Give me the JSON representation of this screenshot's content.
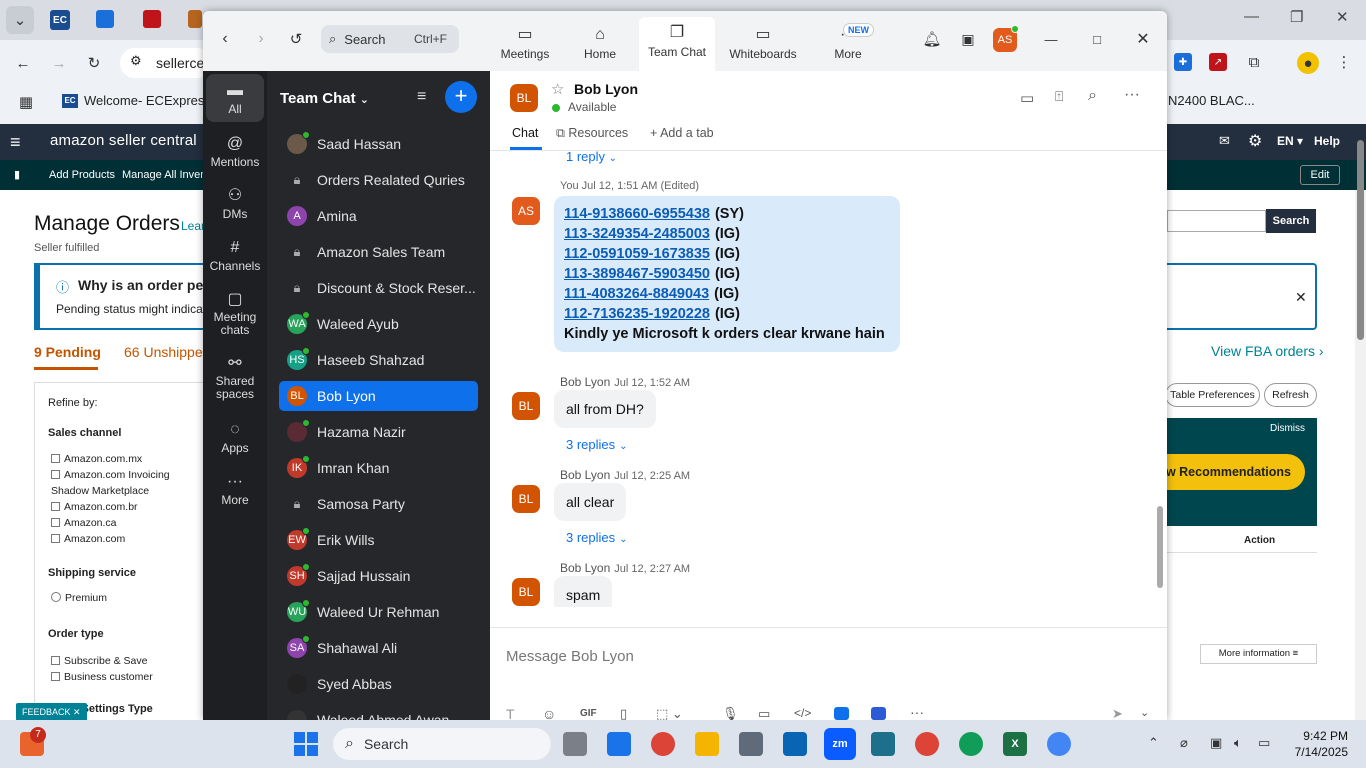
{
  "browser": {
    "tab_texts": [
      "EC",
      "",
      "",
      ""
    ],
    "address": "sellerce",
    "bookmark": "Welcome- ECExpres...",
    "right_fragment": "N2400 BLAC..."
  },
  "amazon": {
    "brand": "amazon seller central",
    "nav_right": [
      "EN ▾",
      "Help"
    ],
    "subnav": [
      "Add Products",
      "Manage All Invento"
    ],
    "edit": "Edit",
    "page_title": "Manage Orders",
    "learn": "Lear",
    "subtitle": "Seller fulfilled",
    "banner_title": "Why is an order pen",
    "banner_text": "Pending status might indicate a",
    "tab_pending": "9 Pending",
    "tab_unshipped": "66 Unshipped",
    "refine": "Refine by:",
    "sales_channel": "Sales channel",
    "channels": [
      "Amazon.com.mx",
      "Amazon.com Invoicing Shadow Marketplace",
      "Amazon.com.br",
      "Amazon.ca",
      "Amazon.com"
    ],
    "shipping_service": "Shipping service",
    "premium": "Premium",
    "order_type": "Order type",
    "order_types": [
      "Subscribe & Save",
      "Business customer"
    ],
    "settings_type": "ng Settings Type",
    "feedback": "FEEDBACK",
    "search_btn": "Search",
    "view_fba": "View FBA orders ›",
    "table_prefs": "Table Preferences",
    "refresh": "Refresh",
    "dismiss": "Dismiss",
    "recommend": "ew Recommendations",
    "action": "Action",
    "more_info": "More information ≡"
  },
  "zoom": {
    "search_label": "Search",
    "search_shortcut": "Ctrl+F",
    "tabs": [
      "Meetings",
      "Home",
      "Team Chat",
      "Whiteboards",
      "More"
    ],
    "new_badge": "NEW",
    "user_initials": "AS",
    "rail": [
      "All",
      "Mentions",
      "DMs",
      "Channels",
      "Meeting chats",
      "Shared spaces",
      "Apps",
      "More"
    ],
    "sidebar_title": "Team Chat",
    "contacts": [
      {
        "name": "Saad Hassan",
        "type": "photo",
        "color": "#6b5a4a",
        "init": "",
        "online": true
      },
      {
        "name": "Orders Realated Quries",
        "type": "lock"
      },
      {
        "name": "Amina",
        "type": "avatar",
        "color": "#8e44ad",
        "init": "A",
        "online": false
      },
      {
        "name": "Amazon Sales Team",
        "type": "lock"
      },
      {
        "name": "Discount & Stock Reser...",
        "type": "lock"
      },
      {
        "name": "Waleed Ayub",
        "type": "avatar",
        "color": "#27a35a",
        "init": "WA",
        "online": true
      },
      {
        "name": "Haseeb Shahzad",
        "type": "avatar",
        "color": "#16a085",
        "init": "HS",
        "online": true
      },
      {
        "name": "Bob Lyon",
        "type": "avatar",
        "color": "#d35400",
        "init": "BL",
        "online": false
      },
      {
        "name": "Hazama Nazir",
        "type": "photo",
        "color": "#5a2a35",
        "init": "",
        "online": true
      },
      {
        "name": "Imran Khan",
        "type": "avatar",
        "color": "#c0392b",
        "init": "IK",
        "online": true
      },
      {
        "name": "Samosa Party",
        "type": "lock"
      },
      {
        "name": "Erik Wills",
        "type": "avatar",
        "color": "#c0392b",
        "init": "EW",
        "online": true
      },
      {
        "name": "Sajjad Hussain",
        "type": "avatar",
        "color": "#c0392b",
        "init": "SH",
        "online": true
      },
      {
        "name": "Waleed Ur Rehman",
        "type": "avatar",
        "color": "#27a35a",
        "init": "WU",
        "online": true
      },
      {
        "name": "Shahawal Ali",
        "type": "avatar",
        "color": "#8e44ad",
        "init": "SA",
        "online": true
      },
      {
        "name": "Syed Abbas",
        "type": "photo",
        "color": "#222",
        "init": "",
        "online": false
      },
      {
        "name": "Waleed Ahmed Awan",
        "type": "photo",
        "color": "#333",
        "init": "",
        "online": false
      }
    ],
    "chat_name": "Bob Lyon",
    "chat_initials": "BL",
    "chat_status": "Available",
    "chat_tabs": [
      "Chat",
      "Resources",
      "Add a tab"
    ],
    "top_reply": "1 reply",
    "my_meta": "You Jul 12, 1:51 AM (Edited)",
    "my_initials": "AS",
    "orders": [
      {
        "id": "114-9138660-6955438",
        "tag": "(SY)"
      },
      {
        "id": "113-3249354-2485003",
        "tag": "(IG)"
      },
      {
        "id": "112-0591059-1673835",
        "tag": "(IG)"
      },
      {
        "id": "113-3898467-5903450",
        "tag": "(IG)"
      },
      {
        "id": "111-4083264-8849043",
        "tag": "(IG)"
      },
      {
        "id": "112-7136235-1920228",
        "tag": "(IG)"
      }
    ],
    "order_note": "Kindly ye Microsoft k orders clear krwane hain",
    "messages": [
      {
        "sender": "Bob Lyon",
        "time": "Jul 12, 1:52 AM",
        "text": "all from DH?",
        "replies": "3 replies"
      },
      {
        "sender": "Bob Lyon",
        "time": "Jul 12, 2:25 AM",
        "text": "all clear",
        "replies": "3 replies"
      },
      {
        "sender": "Bob Lyon",
        "time": "Jul 12, 2:27 AM",
        "text": "spam",
        "replies": ""
      }
    ],
    "composer_placeholder": "Message Bob Lyon",
    "composer_gif": "GIF"
  },
  "taskbar": {
    "search": "Search",
    "badge": "7",
    "time": "9:42 PM",
    "date": "7/14/2025"
  },
  "colors": {
    "accent": "#0e71eb",
    "amazon_dark": "#232f3e",
    "teal": "#008296"
  }
}
